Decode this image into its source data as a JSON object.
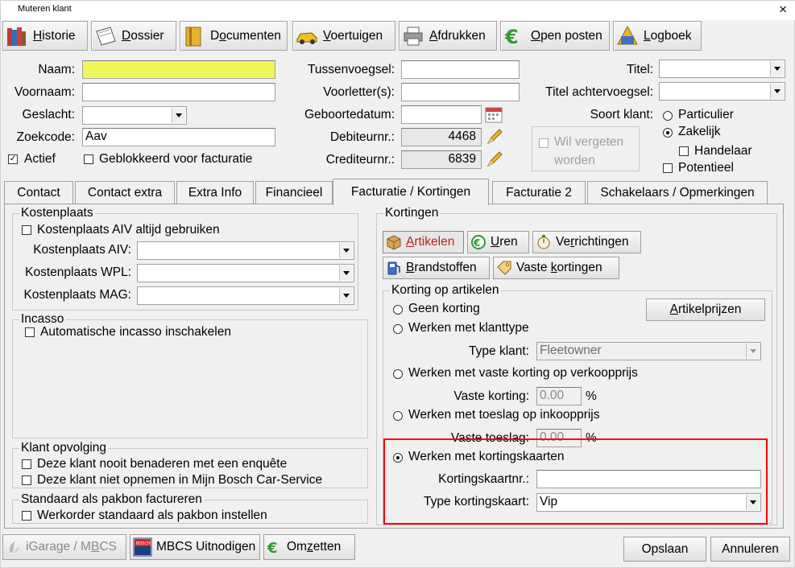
{
  "window": {
    "title": "Muteren klant",
    "close": "×"
  },
  "toolbar": {
    "historie": {
      "pre": "",
      "u": "H",
      "post": "istorie"
    },
    "dossier": {
      "pre": "",
      "u": "D",
      "post": "ossier"
    },
    "documenten": {
      "pre": "D",
      "u": "o",
      "post": "cumenten"
    },
    "voertuigen": {
      "pre": "",
      "u": "V",
      "post": "oertuigen"
    },
    "afdrukken": {
      "pre": "",
      "u": "A",
      "post": "fdrukken"
    },
    "openposten": {
      "pre": "",
      "u": "O",
      "post": "pen posten"
    },
    "logboek": {
      "pre": "",
      "u": "L",
      "post": "ogboek"
    }
  },
  "form": {
    "naam": {
      "label": "Naam:",
      "value": ""
    },
    "voornaam": {
      "label": "Voornaam:",
      "value": ""
    },
    "geslacht": {
      "label": "Geslacht:",
      "value": ""
    },
    "zoekcode": {
      "label": "Zoekcode:",
      "value": "Aav"
    },
    "actief": {
      "label": "Actief",
      "checked": true
    },
    "geblokkeerd": {
      "label": "Geblokkeerd voor facturatie",
      "checked": false
    },
    "tussenvoegsel": {
      "label": "Tussenvoegsel:",
      "value": ""
    },
    "voorletters": {
      "label": "Voorletter(s):",
      "value": ""
    },
    "geboortedatum": {
      "label": "Geboortedatum:",
      "value": ""
    },
    "debiteurnr": {
      "label": "Debiteurnr.:",
      "value": "4468"
    },
    "crediteurnr": {
      "label": "Crediteurnr.:",
      "value": "6839"
    },
    "titel": {
      "label": "Titel:",
      "value": ""
    },
    "titelachter": {
      "label": "Titel achtervoegsel:",
      "value": ""
    },
    "soortklant": {
      "label": "Soort klant:",
      "options": [
        "Particulier",
        "Zakelijk"
      ],
      "selected": "Zakelijk"
    },
    "handelaar": {
      "label": "Handelaar",
      "checked": false
    },
    "potentieel": {
      "label": "Potentieel",
      "checked": false
    },
    "wilvergeten": {
      "line1": "Wil vergeten",
      "line2": "worden",
      "checked": false
    }
  },
  "tabs": [
    "Contact",
    "Contact extra",
    "Extra Info",
    "Financieel",
    "Facturatie / Kortingen",
    "Facturatie 2",
    "Schakelaars / Opmerkingen"
  ],
  "active_tab": "Facturatie / Kortingen",
  "kostenplaats": {
    "title": "Kostenplaats",
    "altijd": "Kostenplaats AIV altijd gebruiken",
    "aiv": "Kostenplaats AIV:",
    "wpl": "Kostenplaats WPL:",
    "mag": "Kostenplaats MAG:"
  },
  "incasso": {
    "title": "Incasso",
    "auto": "Automatische incasso inschakelen"
  },
  "opvolging": {
    "title": "Klant opvolging",
    "enquete": "Deze klant nooit benaderen met een enquête",
    "bosch": "Deze klant niet opnemen in Mijn Bosch Car-Service"
  },
  "pakbon": {
    "title": "Standaard als pakbon factureren",
    "werkorder": "Werkorder standaard als pakbon instellen"
  },
  "kortingen": {
    "title": "Kortingen",
    "artikelen": {
      "pre": "",
      "u": "A",
      "post": "rtikelen"
    },
    "uren": {
      "pre": "",
      "u": "U",
      "post": "ren"
    },
    "verrichtingen": {
      "pre": "Ve",
      "u": "r",
      "post": "richtingen"
    },
    "brandstoffen": {
      "pre": "",
      "u": "B",
      "post": "randstoffen"
    },
    "vastekortingen": {
      "pre": "Vaste ",
      "u": "k",
      "post": "ortingen"
    }
  },
  "kortingartikelen": {
    "title": "Korting op artikelen",
    "geen": "Geen korting",
    "klanttype": "Werken met klanttype",
    "typeklant_label": "Type klant:",
    "typeklant_value": "Fleetowner",
    "vaste": "Werken met vaste korting op verkoopprijs",
    "vastekorting_label": "Vaste korting:",
    "vastekorting_value": "0.00",
    "toeslag": "Werken met toeslag op inkoopprijs",
    "vastetoeslag_label": "Vaste toeslag:",
    "vastetoeslag_value": "0.00",
    "pct": "%",
    "kaarten": "Werken met kortingskaarten",
    "kaartnr_label": "Kortingskaartnr.:",
    "kaartnr_value": "",
    "typekaart_label": "Type kortingskaart:",
    "typekaart_value": "Vip",
    "selected": "kaarten",
    "artikelprijzen": {
      "pre": "",
      "u": "A",
      "post": "rtikelprijzen"
    }
  },
  "bottom": {
    "igarage": {
      "pre": "iGarage / M",
      "u": "B",
      "post": "CS"
    },
    "mbcs": "MBCS Uitnodigen",
    "omzetten": {
      "pre": "Om",
      "u": "z",
      "post": "etten"
    },
    "opslaan": "Opslaan",
    "annuleren": "Annuleren"
  },
  "colors": {
    "highlight": "#ff0000",
    "naam_bg": "#f0f65a"
  }
}
